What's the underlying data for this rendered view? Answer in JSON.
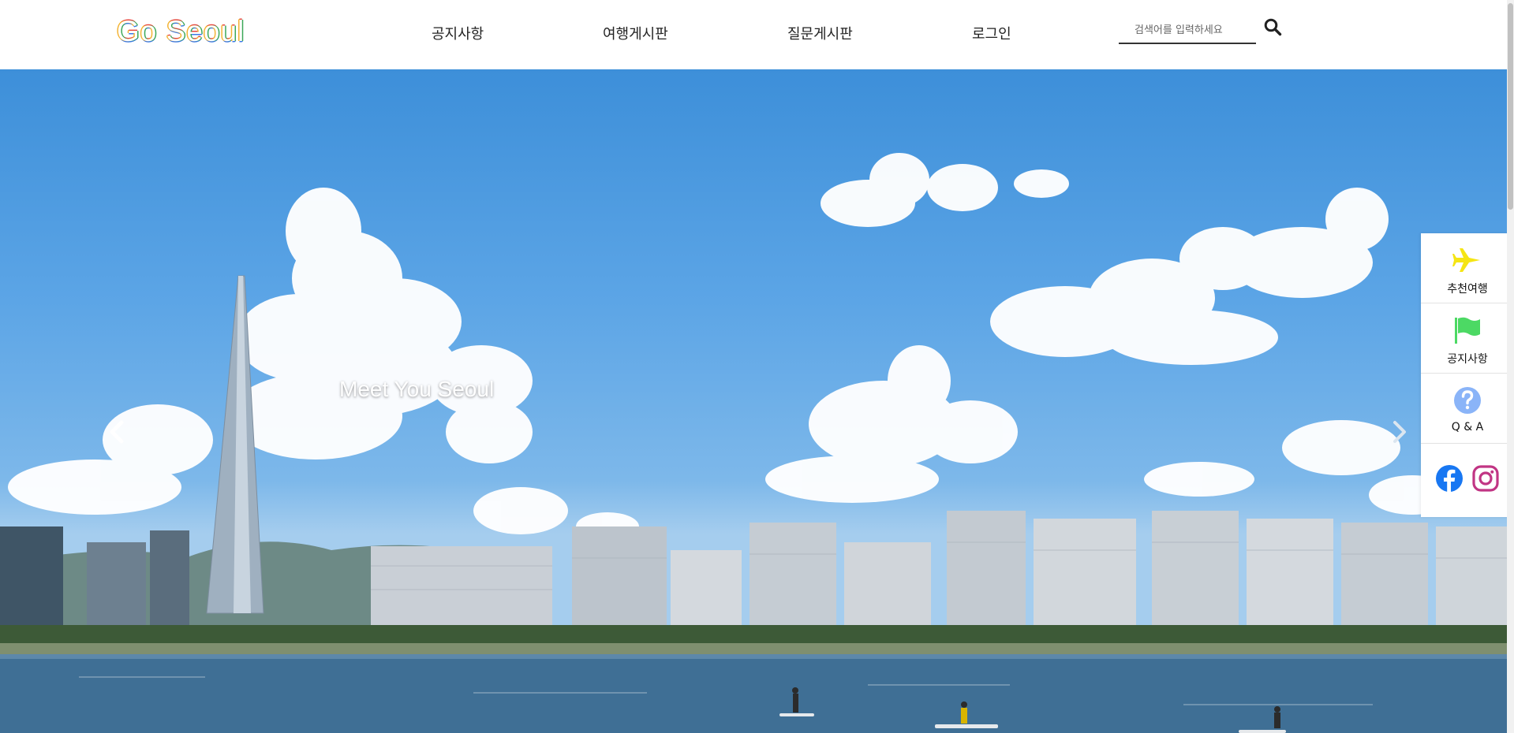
{
  "header": {
    "logo": "Go Seoul",
    "nav": [
      {
        "label": "공지사항"
      },
      {
        "label": "여행게시판"
      },
      {
        "label": "질문게시판"
      },
      {
        "label": "로그인"
      }
    ],
    "search": {
      "placeholder": "검색어를 입력하세요",
      "value": "",
      "icon": "search-icon"
    }
  },
  "hero": {
    "caption": "Meet You Seoul",
    "prev_icon": "chevron-left-icon",
    "next_icon": "chevron-right-icon"
  },
  "quick_menu": {
    "items": [
      {
        "label": "추천여행",
        "icon": "airplane-icon",
        "color": "#f5e514"
      },
      {
        "label": "공지사항",
        "icon": "flag-icon",
        "color": "#4cd964"
      },
      {
        "label": "Q & A",
        "icon": "question-icon",
        "color": "#8ab4f8"
      }
    ],
    "social": [
      {
        "name": "facebook",
        "icon": "facebook-icon",
        "color": "#1877f2"
      },
      {
        "name": "instagram",
        "icon": "instagram-icon",
        "color": "#c13584"
      }
    ]
  }
}
